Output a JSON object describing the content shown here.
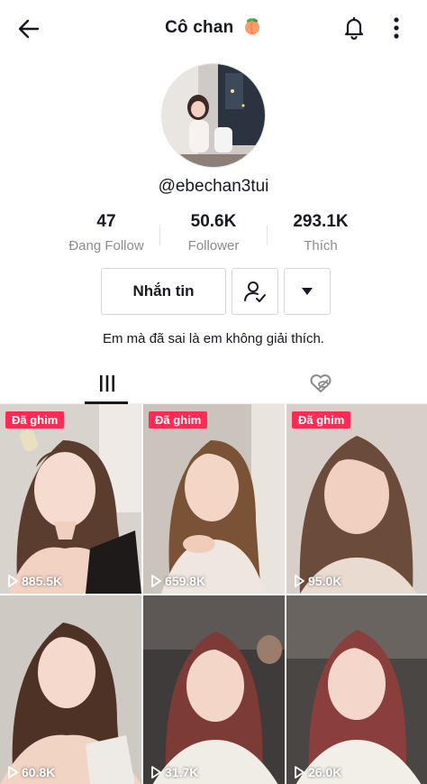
{
  "header": {
    "title": "Cô chan",
    "back_icon": "arrow-left-icon",
    "bell_icon": "bell-icon",
    "more_icon": "more-vertical-icon",
    "title_emoji": "peach-emoji"
  },
  "profile": {
    "username": "@ebechan3tui",
    "bio": "Em mà đã sai là em không giải thích."
  },
  "stats": [
    {
      "value": "47",
      "label": "Đang Follow"
    },
    {
      "value": "50.6K",
      "label": "Follower"
    },
    {
      "value": "293.1K",
      "label": "Thích"
    }
  ],
  "actions": {
    "message_label": "Nhắn tin",
    "user_icon": "user-check-icon",
    "dropdown_icon": "caret-down-icon"
  },
  "tabs": [
    {
      "icon": "grid-icon",
      "active": true
    },
    {
      "icon": "liked-hidden-icon",
      "active": false
    }
  ],
  "videos": [
    {
      "pinned": "Đã ghim",
      "views": "885.5K"
    },
    {
      "pinned": "Đã ghim",
      "views": "659.8K"
    },
    {
      "pinned": "Đã ghim",
      "views": "95.0K"
    },
    {
      "pinned": "",
      "views": "60.8K"
    },
    {
      "pinned": "",
      "views": "31.7K"
    },
    {
      "pinned": "",
      "views": "26.0K"
    }
  ],
  "colors": {
    "accent": "#fe2c55",
    "text": "#161823",
    "muted": "#8a8b91"
  }
}
